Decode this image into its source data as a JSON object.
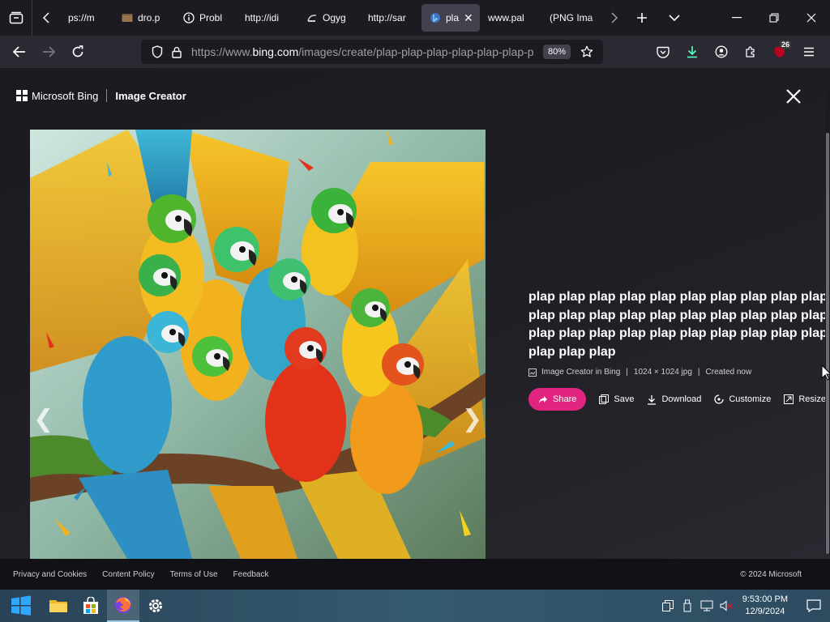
{
  "browser": {
    "tabs": [
      {
        "label": "ps://m",
        "favicon": "back-arrow-icon"
      },
      {
        "label": "dro.p",
        "favicon": "folder-icon"
      },
      {
        "label": "Probl",
        "favicon": "info-icon"
      },
      {
        "label": "http://idi",
        "favicon": "none"
      },
      {
        "label": "Ogyg",
        "favicon": "generic-page-icon"
      },
      {
        "label": "http://sar",
        "favicon": "none"
      },
      {
        "label": "pla",
        "favicon": "bing-icon",
        "active": true
      },
      {
        "label": "www.pal",
        "favicon": "none"
      },
      {
        "label": "(PNG Ima",
        "favicon": "none"
      }
    ],
    "url_prefix": "https://www.",
    "url_domain": "bing.com",
    "url_path": "/images/create/plap-plap-plap-plap-plap-plap-p",
    "zoom": "80%",
    "extensions_badge": "26"
  },
  "page": {
    "brand_name": "Microsoft Bing",
    "product_name": "Image Creator",
    "prompt_text": "plap plap plap plap plap plap plap plap plap plap plap plap plap plap plap plap plap plap plap plap plap plap plap plap plap plap plap plap plap plap plap plap plap",
    "meta": {
      "source": "Image Creator in Bing",
      "dimensions": "1024 × 1024 jpg",
      "created": "Created now"
    },
    "actions": {
      "share": "Share",
      "save": "Save",
      "download": "Download",
      "customize": "Customize",
      "resize": "Resize"
    },
    "image_alt": "parrots-illustration"
  },
  "footer": {
    "links": [
      "Privacy and Cookies",
      "Content Policy",
      "Terms of Use",
      "Feedback"
    ],
    "copyright": "© 2024 Microsoft"
  },
  "taskbar": {
    "time": "9:53:00 PM",
    "date": "12/9/2024"
  },
  "colors": {
    "share_button": "#e0247f",
    "chrome_dark": "#1c1b22",
    "active_tab": "#42414d"
  }
}
